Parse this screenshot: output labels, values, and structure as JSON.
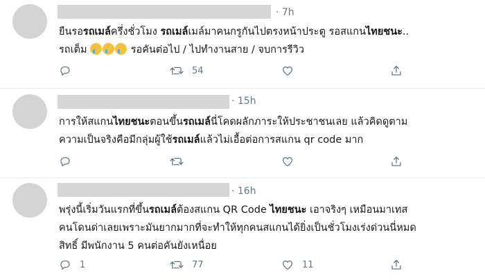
{
  "tweets": [
    {
      "time": "· 7h",
      "lines": [
        [
          {
            "t": "ยืนรอ"
          },
          {
            "t": "รถเมล์",
            "b": true
          },
          {
            "t": "ครึ่งชั่วโมง "
          },
          {
            "t": "รถเมล์",
            "b": true
          },
          {
            "t": "เมล์มาคนกรูกันไปตรงหน้าประตู รอสแกน"
          },
          {
            "t": "ไทยชนะ",
            "b": true
          },
          {
            "t": ".."
          }
        ],
        [
          {
            "t": "รถเต็ม "
          },
          {
            "emoji": "crying-face-emoji"
          },
          {
            "emoji": "crying-face-emoji"
          },
          {
            "emoji": "crying-face-emoji"
          },
          {
            "t": " รอคันต่อไป / ไปทำงานสาย / จบการรีวิว"
          }
        ]
      ],
      "actions": {
        "reply": "",
        "retweet": "54",
        "like": "",
        "share": ""
      }
    },
    {
      "time": "· 15h",
      "lines": [
        [
          {
            "t": "การให้สแกน"
          },
          {
            "t": "ไทยชนะ",
            "b": true
          },
          {
            "t": "ตอนขึ้น"
          },
          {
            "t": "รถเมล์",
            "b": true
          },
          {
            "t": "นี่โคดผลักภาระให้ประชาชนเลย แล้วคิดดูตาม"
          }
        ],
        [
          {
            "t": "ความเป็นจริงคือมีกลุ่มผู้ใช้"
          },
          {
            "t": "รถเมล์",
            "b": true
          },
          {
            "t": "แล้วไม่เอื้อต่อการสแกน qr code มาก"
          }
        ]
      ],
      "actions": {
        "reply": "",
        "retweet": "",
        "like": "",
        "share": ""
      }
    },
    {
      "time": "· 16h",
      "lines": [
        [
          {
            "t": "พรุ่งนี้เริ่มวันแรกที่ขึ้น"
          },
          {
            "t": "รถเมล์",
            "b": true
          },
          {
            "t": "ต้องสแกน QR Code "
          },
          {
            "t": "ไทยชนะ",
            "b": true
          },
          {
            "t": " เอาจริงๆ เหมือนมาเทส"
          }
        ],
        [
          {
            "t": "คนโดนด่าเลยเพราะมันยากมากที่จะทำให้ทุกคนสแกนได้ยิ่งเป็นชั่วโมงเร่งด่วนนี่หมด"
          }
        ],
        [
          {
            "t": "สิทธิ์ มีพนักงาน 5 คนต่อคันยังเหนื่อย"
          }
        ]
      ],
      "actions": {
        "reply": "1",
        "retweet": "77",
        "like": "11",
        "share": ""
      }
    }
  ],
  "icons": {
    "reply": "reply-icon",
    "retweet": "retweet-icon",
    "like": "heart-icon",
    "share": "share-icon",
    "emoji": "crying-face-emoji"
  },
  "colors": {
    "text": "#14171a",
    "muted": "#657786",
    "divider": "#e6ecf0",
    "placeholder": "#d6d6d6"
  }
}
